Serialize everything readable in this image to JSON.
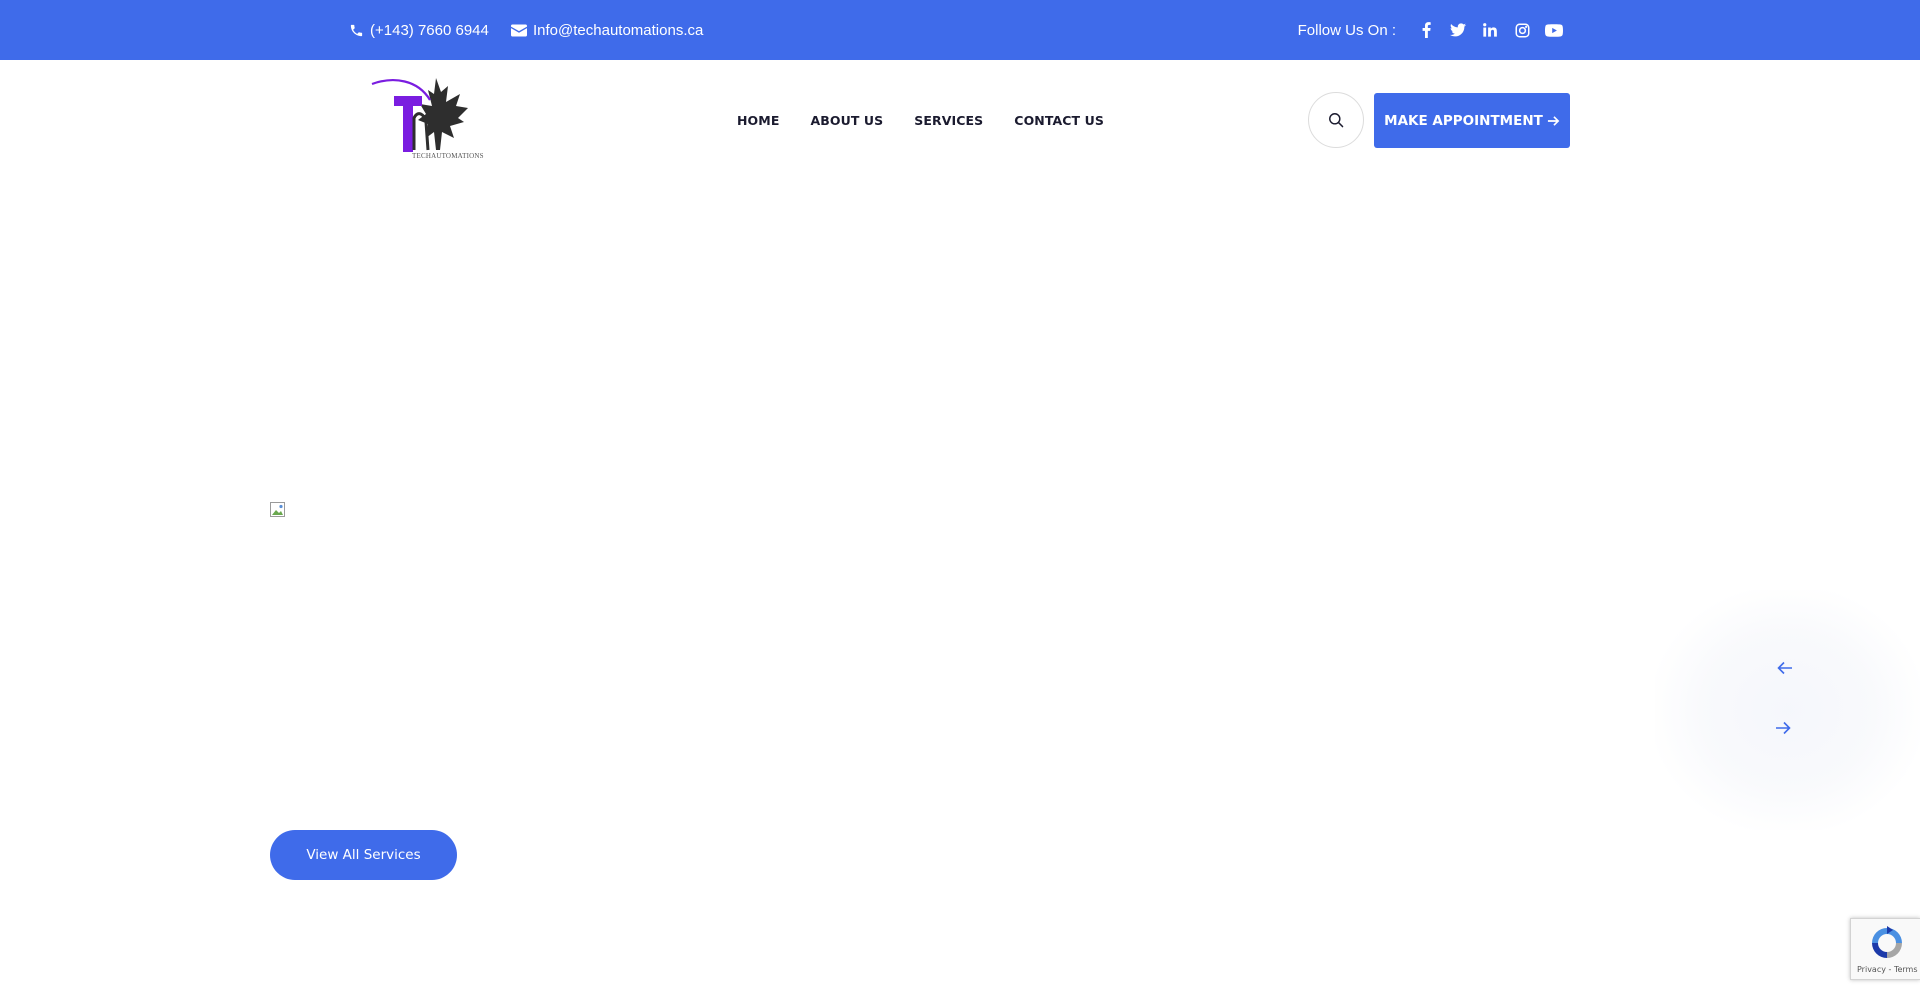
{
  "topbar": {
    "phone": "(+143) 7660 6944",
    "email": "Info@techautomations.ca",
    "follow_label": "Follow Us On :",
    "socials": [
      {
        "icon": "facebook-icon"
      },
      {
        "icon": "twitter-icon"
      },
      {
        "icon": "linkedin-icon"
      },
      {
        "icon": "instagram-icon"
      },
      {
        "icon": "youtube-icon"
      }
    ]
  },
  "header": {
    "logo_text": "TECHAUTOMATIONS",
    "nav": [
      {
        "label": "HOME"
      },
      {
        "label": "ABOUT US"
      },
      {
        "label": "SERVICES"
      },
      {
        "label": "CONTACT US"
      }
    ],
    "appointment_label": "MAKE APPOINTMENT"
  },
  "main": {
    "services_button_label": "View All Services"
  },
  "recaptcha": {
    "privacy_label": "Privacy",
    "terms_label": "Terms"
  },
  "colors": {
    "brand_blue": "#3f6bea",
    "logo_purple": "#7a1de0",
    "logo_dark": "#2e2e2e"
  }
}
